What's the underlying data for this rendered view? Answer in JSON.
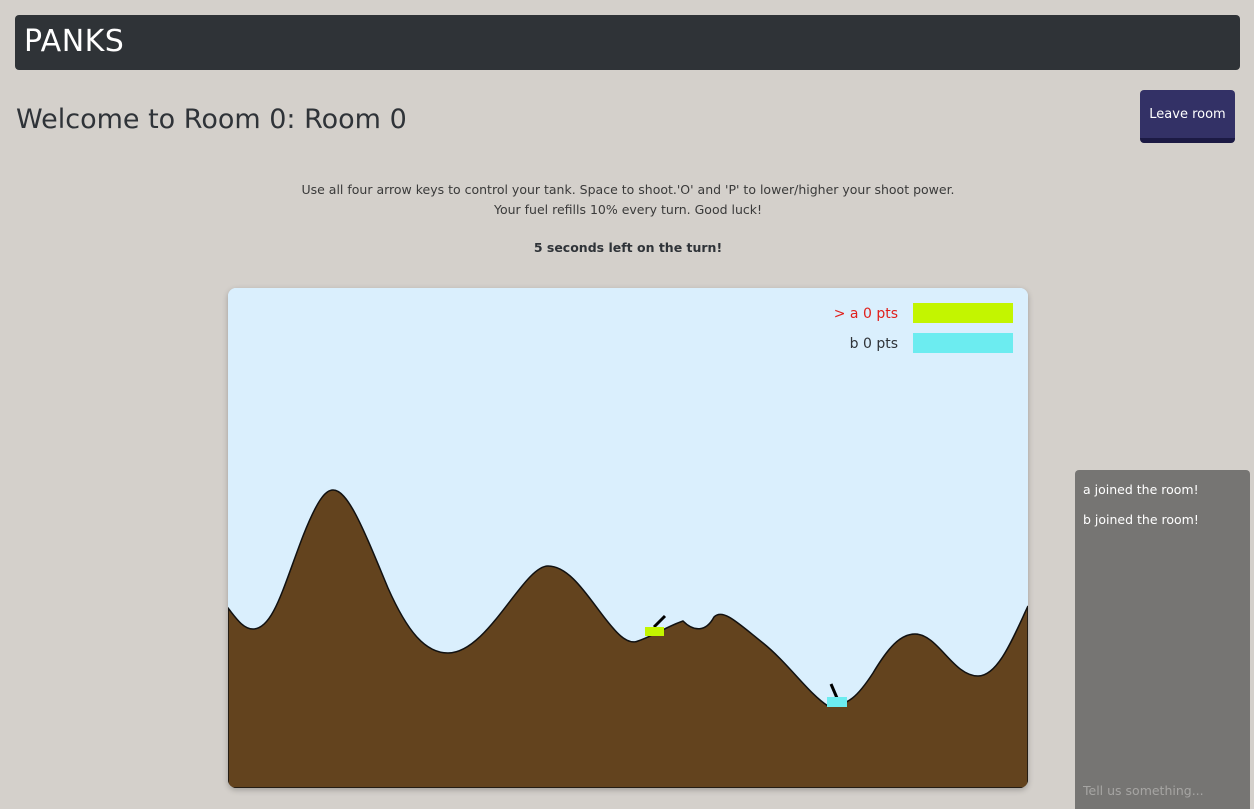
{
  "app": {
    "brand": "PANKS"
  },
  "room": {
    "title": "Welcome to Room 0: Room 0",
    "leave_label": "Leave room"
  },
  "instructions": {
    "line1": "Use all four arrow keys to control your tank. Space to shoot.'O' and 'P' to lower/higher your shoot power.",
    "line2": "Your fuel refills 10% every turn. Good luck!"
  },
  "turn": {
    "timer_text": "5 seconds left on the turn!"
  },
  "game": {
    "sky_color": "#daeffd",
    "ground_color": "#63431e",
    "players": [
      {
        "label": "> a 0 pts",
        "color": "#c3f500",
        "text_color": "#e0201c",
        "active": true,
        "fuel": 1.0
      },
      {
        "label": "b 0 pts",
        "color": "#6cecf0",
        "text_color": "#2f3338",
        "active": false,
        "fuel": 1.0
      }
    ]
  },
  "chat": {
    "messages": [
      "a joined the room!",
      "b joined the room!"
    ],
    "input_placeholder": "Tell us something..."
  }
}
